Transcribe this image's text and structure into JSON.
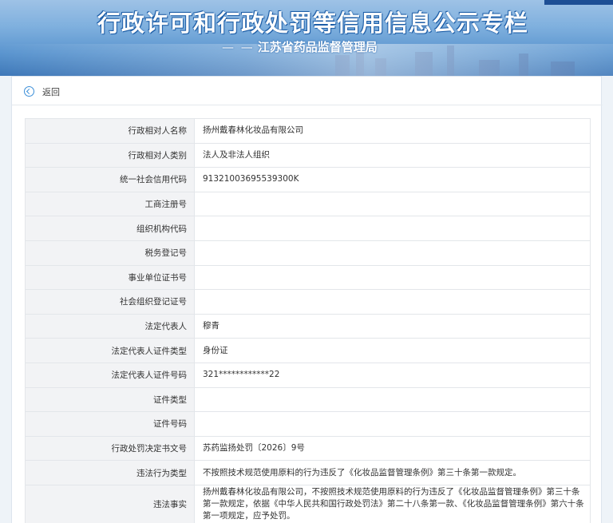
{
  "banner": {
    "title": "行政许可和行政处罚等信用信息公示专栏",
    "subtitle_dash": "— —",
    "subtitle": "江苏省药品监督管理局"
  },
  "back": {
    "label": "返回"
  },
  "rows": [
    {
      "label": "行政相对人名称",
      "value": "扬州戴春林化妆品有限公司"
    },
    {
      "label": "行政相对人类别",
      "value": "法人及非法人组织"
    },
    {
      "label": "统一社会信用代码",
      "value": "91321003695539300K"
    },
    {
      "label": "工商注册号",
      "value": ""
    },
    {
      "label": "组织机构代码",
      "value": ""
    },
    {
      "label": "税务登记号",
      "value": ""
    },
    {
      "label": "事业单位证书号",
      "value": ""
    },
    {
      "label": "社会组织登记证号",
      "value": ""
    },
    {
      "label": "法定代表人",
      "value": "穆青"
    },
    {
      "label": "法定代表人证件类型",
      "value": "身份证"
    },
    {
      "label": "法定代表人证件号码",
      "value": "321************22"
    },
    {
      "label": "证件类型",
      "value": ""
    },
    {
      "label": "证件号码",
      "value": ""
    },
    {
      "label": "行政处罚决定书文号",
      "value": "苏药监扬处罚〔2026〕9号"
    },
    {
      "label": "违法行为类型",
      "value": "不按照技术规范使用原料的行为违反了《化妆品监督管理条例》第三十条第一款规定。"
    },
    {
      "label": "违法事实",
      "value": "扬州戴春林化妆品有限公司，不按照技术规范使用原料的行为违反了《化妆品监督管理条例》第三十条第一款规定，依据《中华人民共和国行政处罚法》第二十八条第一款、《化妆品监督管理条例》第六十条第一项规定，应予处罚。"
    }
  ],
  "colors": {
    "accent": "#3b8ed8",
    "label_bg": "#f2f3f5",
    "banner": "#5b95cf"
  },
  "icons": {
    "back": "back-circle-arrow-icon"
  }
}
